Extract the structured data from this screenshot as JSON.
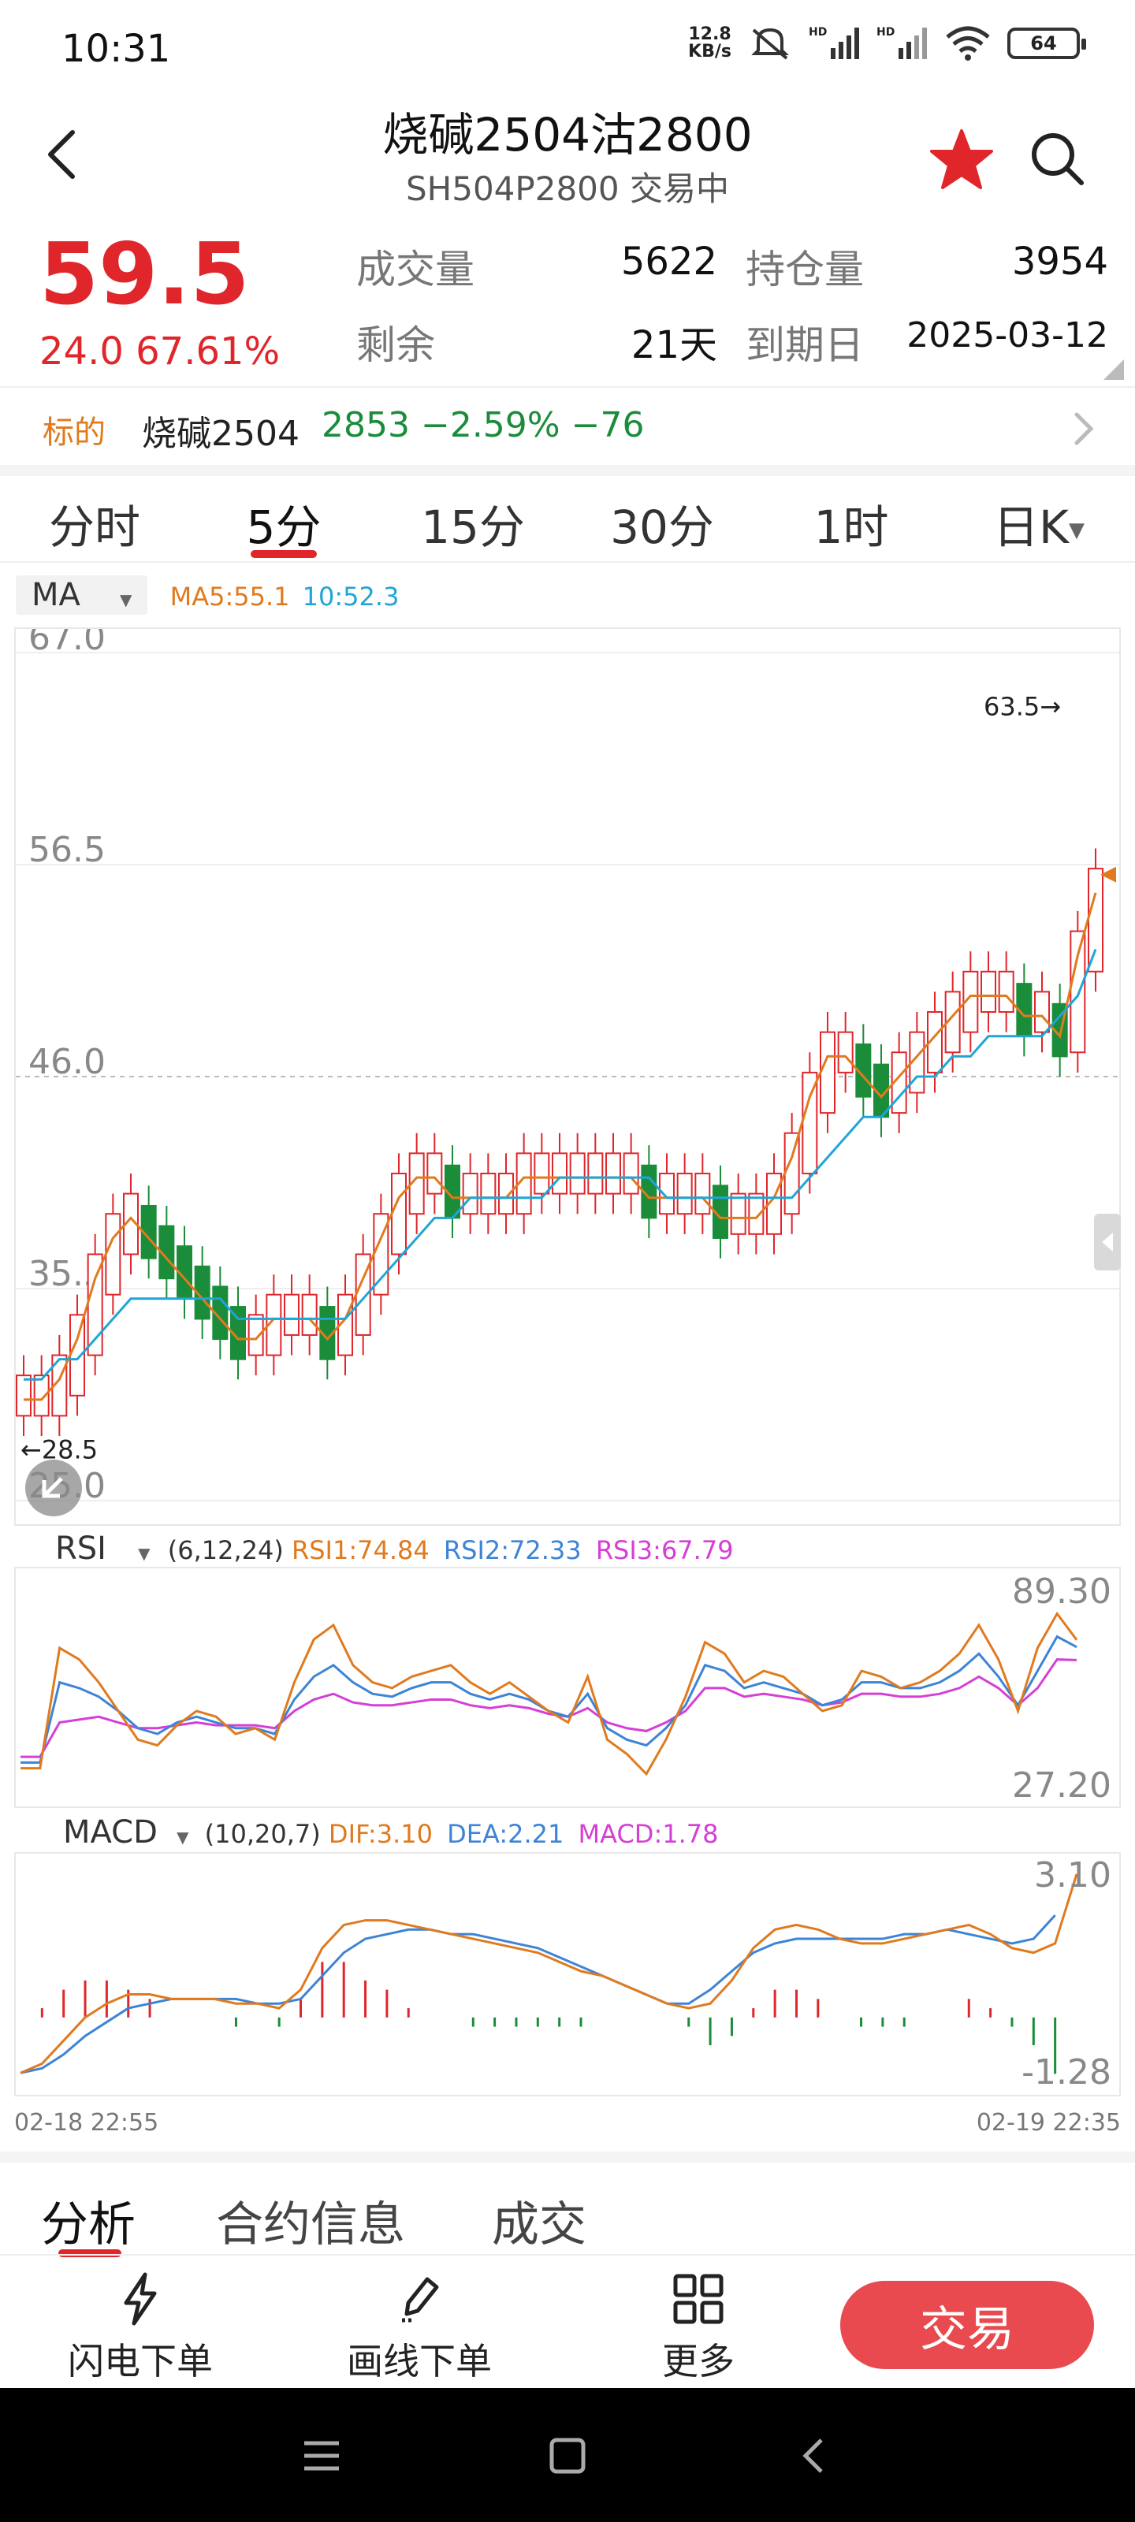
{
  "status": {
    "time": "10:31",
    "net_speed_value": "12.8",
    "net_speed_unit": "KB/s",
    "battery": "64",
    "sim1": "HD",
    "sim2": "HD"
  },
  "header": {
    "title": "烧碱2504沽2800",
    "subtitle": "SH504P2800 交易中"
  },
  "quote": {
    "price": "59.5",
    "change": "24.0 67.61%",
    "volume_label": "成交量",
    "volume_value": "5622",
    "oi_label": "持仓量",
    "oi_value": "3954",
    "remaining_label": "剩余",
    "remaining_value": "21天",
    "expiry_label": "到期日",
    "expiry_value": "2025-03-12"
  },
  "underlying": {
    "label": "标的",
    "name": "烧碱2504",
    "value": "2853 −2.59% −76"
  },
  "period_tabs": [
    "分时",
    "5分",
    "15分",
    "30分",
    "1时",
    "日K"
  ],
  "active_period": "5分",
  "indicators": {
    "ma": {
      "name": "MA",
      "ma5": "MA5:55.1",
      "ma10": "10:52.3",
      "ma5_color": "#e07a1f",
      "ma10_color": "#1fa5d6"
    },
    "rsi": {
      "name": "RSI",
      "params": "(6,12,24)",
      "rsi1": "RSI1:74.84",
      "rsi2": "RSI2:72.33",
      "rsi3": "RSI3:67.79",
      "rsi1_color": "#e07a1f",
      "rsi2_color": "#3d84d6",
      "rsi3_color": "#d63fd6"
    },
    "macd": {
      "name": "MACD",
      "params": "(10,20,7)",
      "dif": "DIF:3.10",
      "dea": "DEA:2.21",
      "macd": "MACD:1.78",
      "dif_color": "#e07a1f",
      "dea_color": "#3d84d6",
      "macd_color": "#d63fd6"
    }
  },
  "chart_data": {
    "type": "candlestick",
    "title": "",
    "y_ticks": [
      "67.0",
      "56.5",
      "46.0",
      "35.5",
      "25.0"
    ],
    "ylim": [
      25.0,
      67.0
    ],
    "max_label": "63.5→",
    "min_label": "←28.5",
    "ma5": [
      30,
      30,
      31,
      33,
      36,
      38,
      39,
      38,
      37,
      36,
      35,
      34,
      33,
      33,
      34,
      34,
      34,
      33,
      34,
      36,
      38,
      40,
      41,
      41,
      40,
      40,
      40,
      40,
      41,
      41,
      41,
      41,
      41,
      41,
      41,
      40,
      40,
      40,
      40,
      39,
      39,
      39,
      40,
      42,
      45,
      47,
      47,
      46,
      45,
      46,
      47,
      48,
      49,
      50,
      50,
      50,
      49,
      49,
      48,
      52,
      55.1
    ],
    "ma10": [
      31,
      31,
      32,
      32,
      33,
      34,
      35,
      35,
      35,
      35,
      35,
      35,
      34,
      34,
      34,
      34,
      34,
      34,
      34,
      35,
      36,
      37,
      38,
      39,
      39,
      40,
      40,
      40,
      40,
      40,
      41,
      41,
      41,
      41,
      41,
      41,
      40,
      40,
      40,
      40,
      40,
      40,
      40,
      40,
      41,
      42,
      43,
      44,
      44,
      45,
      46,
      46,
      47,
      47,
      48,
      48,
      48,
      48,
      49,
      50,
      52.3
    ],
    "rsi": {
      "range_labels": [
        "89.30",
        "27.20"
      ],
      "rsi1": [
        30,
        30,
        72,
        68,
        60,
        50,
        40,
        38,
        45,
        50,
        48,
        42,
        44,
        40,
        60,
        75,
        80,
        66,
        60,
        58,
        62,
        64,
        66,
        60,
        56,
        60,
        55,
        50,
        46,
        62,
        40,
        35,
        28,
        40,
        55,
        74,
        70,
        60,
        64,
        62,
        56,
        50,
        52,
        64,
        62,
        58,
        60,
        64,
        70,
        80,
        68,
        50,
        72,
        84,
        74.84
      ],
      "rsi2": [
        32,
        32,
        60,
        58,
        55,
        50,
        44,
        42,
        46,
        48,
        46,
        44,
        44,
        42,
        54,
        62,
        66,
        60,
        56,
        55,
        58,
        60,
        60,
        56,
        54,
        56,
        54,
        50,
        48,
        56,
        44,
        40,
        38,
        44,
        52,
        66,
        64,
        58,
        60,
        58,
        56,
        52,
        54,
        60,
        60,
        58,
        58,
        60,
        64,
        70,
        62,
        52,
        64,
        76,
        72.33
      ],
      "rsi3": [
        34,
        34,
        46,
        47,
        48,
        46,
        44,
        44,
        45,
        46,
        45,
        45,
        45,
        44,
        50,
        54,
        56,
        53,
        52,
        52,
        53,
        54,
        54,
        52,
        51,
        52,
        51,
        49,
        48,
        51,
        46,
        44,
        43,
        46,
        50,
        58,
        58,
        55,
        56,
        55,
        54,
        52,
        53,
        56,
        56,
        55,
        55,
        56,
        58,
        62,
        58,
        52,
        58,
        68,
        67.79
      ]
    },
    "macd": {
      "range_labels": [
        "3.10",
        "-1.28"
      ],
      "x_labels": [
        "02-18 22:55",
        "02-19 22:35"
      ],
      "dif": [
        -1.2,
        -1.0,
        -0.5,
        0.0,
        0.3,
        0.5,
        0.5,
        0.4,
        0.4,
        0.4,
        0.3,
        0.3,
        0.2,
        0.6,
        1.5,
        2.0,
        2.1,
        2.1,
        2.0,
        1.9,
        1.8,
        1.7,
        1.6,
        1.5,
        1.4,
        1.2,
        1.0,
        0.9,
        0.7,
        0.5,
        0.3,
        0.2,
        0.3,
        0.8,
        1.5,
        1.9,
        2.0,
        1.9,
        1.7,
        1.6,
        1.6,
        1.7,
        1.8,
        1.9,
        2.0,
        1.8,
        1.5,
        1.4,
        1.6,
        3.1
      ],
      "dea": [
        -1.2,
        -1.1,
        -0.8,
        -0.4,
        -0.1,
        0.2,
        0.3,
        0.4,
        0.4,
        0.4,
        0.4,
        0.3,
        0.3,
        0.4,
        0.9,
        1.4,
        1.7,
        1.8,
        1.9,
        1.9,
        1.8,
        1.8,
        1.7,
        1.6,
        1.5,
        1.3,
        1.1,
        0.9,
        0.7,
        0.5,
        0.3,
        0.3,
        0.6,
        1.0,
        1.4,
        1.6,
        1.7,
        1.7,
        1.7,
        1.7,
        1.7,
        1.8,
        1.8,
        1.9,
        1.8,
        1.7,
        1.6,
        1.7,
        2.21
      ]
    }
  },
  "bottom_tabs": [
    "分析",
    "合约信息",
    "成交"
  ],
  "actions": {
    "flash_order": "闪电下单",
    "draw_order": "画线下单",
    "more": "更多",
    "trade": "交易"
  }
}
